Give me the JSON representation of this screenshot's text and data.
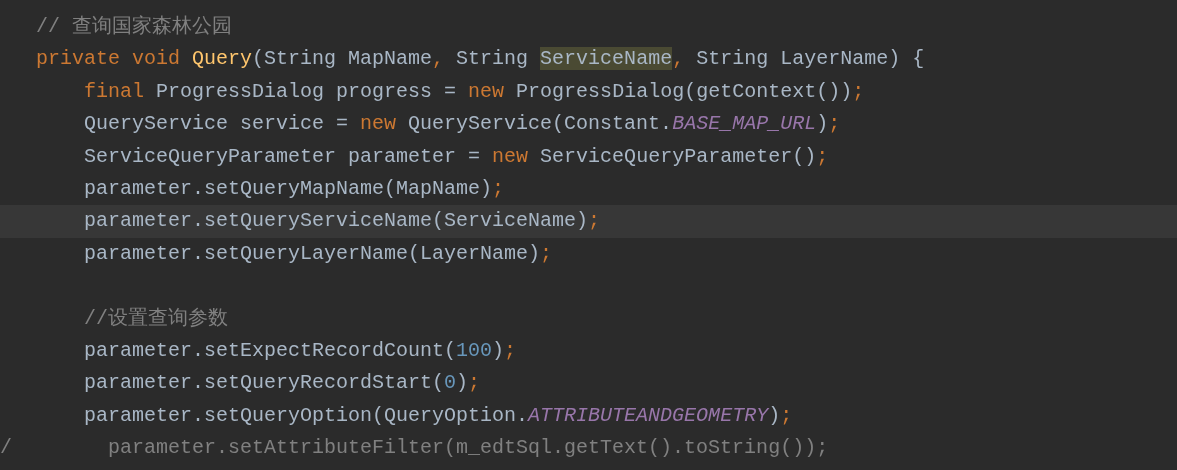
{
  "editor": {
    "lines": [
      {
        "current": false,
        "tokens": [
          {
            "text": "   // 查询国家森林公园",
            "kind": "comment"
          }
        ]
      },
      {
        "current": false,
        "tokens": [
          {
            "text": "   private void ",
            "kind": "keyword"
          },
          {
            "text": "Query",
            "kind": "method"
          },
          {
            "text": "(String MapName",
            "kind": "plain"
          },
          {
            "text": ", ",
            "kind": "keyword"
          },
          {
            "text": "String ",
            "kind": "plain"
          },
          {
            "text": "ServiceName",
            "kind": "highlight"
          },
          {
            "text": ", ",
            "kind": "keyword"
          },
          {
            "text": "String LayerName) {",
            "kind": "plain"
          }
        ]
      },
      {
        "current": false,
        "tokens": [
          {
            "text": "       final ",
            "kind": "keyword"
          },
          {
            "text": "ProgressDialog progress = ",
            "kind": "plain"
          },
          {
            "text": "new ",
            "kind": "keyword"
          },
          {
            "text": "ProgressDialog(getContext())",
            "kind": "plain"
          },
          {
            "text": ";",
            "kind": "keyword"
          }
        ]
      },
      {
        "current": false,
        "tokens": [
          {
            "text": "       QueryService service = ",
            "kind": "plain"
          },
          {
            "text": "new ",
            "kind": "keyword"
          },
          {
            "text": "QueryService(Constant.",
            "kind": "plain"
          },
          {
            "text": "BASE_MAP_URL",
            "kind": "constant"
          },
          {
            "text": ")",
            "kind": "plain"
          },
          {
            "text": ";",
            "kind": "keyword"
          }
        ]
      },
      {
        "current": false,
        "tokens": [
          {
            "text": "       ServiceQueryParameter parameter = ",
            "kind": "plain"
          },
          {
            "text": "new ",
            "kind": "keyword"
          },
          {
            "text": "ServiceQueryParameter()",
            "kind": "plain"
          },
          {
            "text": ";",
            "kind": "keyword"
          }
        ]
      },
      {
        "current": false,
        "tokens": [
          {
            "text": "       parameter.setQueryMapName(MapName)",
            "kind": "plain"
          },
          {
            "text": ";",
            "kind": "keyword"
          }
        ]
      },
      {
        "current": true,
        "tokens": [
          {
            "text": "       parameter.setQueryServiceName(ServiceName)",
            "kind": "plain"
          },
          {
            "text": ";",
            "kind": "keyword"
          }
        ]
      },
      {
        "current": false,
        "tokens": [
          {
            "text": "       parameter.setQueryLayerName(LayerName)",
            "kind": "plain"
          },
          {
            "text": ";",
            "kind": "keyword"
          }
        ]
      },
      {
        "current": false
      },
      {
        "current": false,
        "tokens": [
          {
            "text": "       //设置查询参数",
            "kind": "comment"
          }
        ]
      },
      {
        "current": false,
        "tokens": [
          {
            "text": "       parameter.setExpectRecordCount(",
            "kind": "plain"
          },
          {
            "text": "100",
            "kind": "number"
          },
          {
            "text": ")",
            "kind": "plain"
          },
          {
            "text": ";",
            "kind": "keyword"
          }
        ]
      },
      {
        "current": false,
        "tokens": [
          {
            "text": "       parameter.setQueryRecordStart(",
            "kind": "plain"
          },
          {
            "text": "0",
            "kind": "number"
          },
          {
            "text": ")",
            "kind": "plain"
          },
          {
            "text": ";",
            "kind": "keyword"
          }
        ]
      },
      {
        "current": false,
        "tokens": [
          {
            "text": "       parameter.setQueryOption(QueryOption.",
            "kind": "plain"
          },
          {
            "text": "ATTRIBUTEANDGEOMETRY",
            "kind": "constant"
          },
          {
            "text": ")",
            "kind": "plain"
          },
          {
            "text": ";",
            "kind": "keyword"
          }
        ]
      },
      {
        "current": false,
        "tokens": [
          {
            "text": "/        parameter.setAttributeFilter(m_edtSql.getText().toString());",
            "kind": "comment"
          }
        ]
      }
    ]
  }
}
